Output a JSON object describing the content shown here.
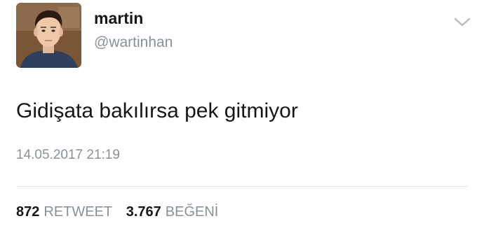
{
  "tweet": {
    "author": {
      "name": "martin",
      "handle": "@wartinhan",
      "avatar_icon": "profile-photo"
    },
    "menu_icon": "chevron-down-icon",
    "text": "Gidişata bakılırsa pek gitmiyor",
    "timestamp": "14.05.2017 21:19",
    "stats": {
      "retweets": {
        "count": "872",
        "label": "RETWEET"
      },
      "likes": {
        "count": "3.767",
        "label": "BEĞENİ"
      }
    }
  },
  "colors": {
    "primary_text": "#14171a",
    "secondary_text": "#8a9196",
    "divider": "#e1e8ed",
    "background": "#ffffff"
  }
}
